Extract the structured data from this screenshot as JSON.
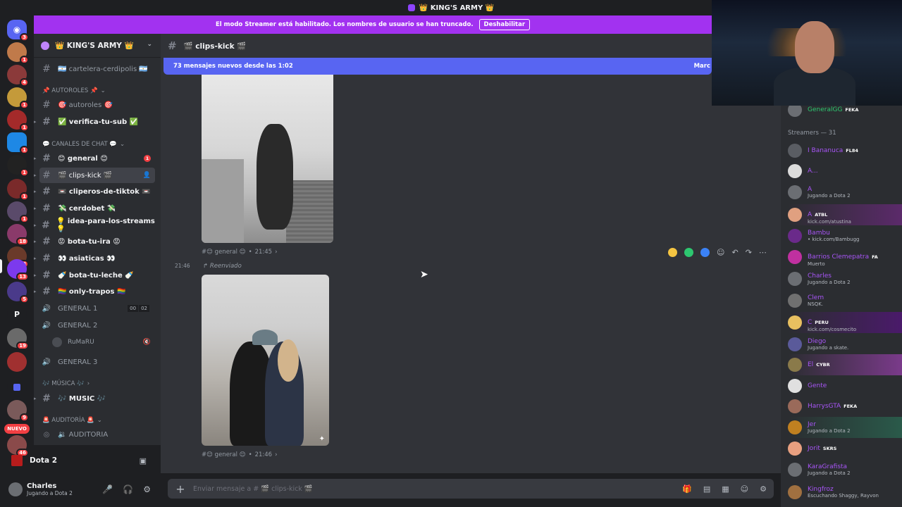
{
  "titlebar": {
    "title": "👑 KING'S ARMY 👑"
  },
  "streamer_banner": {
    "text": "El modo Streamer está habilitado. Los nombres de usuario se han truncado.",
    "button": "Deshabilitar"
  },
  "server": {
    "name": "👑 KING'S ARMY 👑"
  },
  "servers": {
    "badges": [
      "3",
      "1",
      "4",
      "1",
      "1",
      "1",
      "1",
      "1",
      "1",
      "18",
      "18",
      "13",
      "5",
      "19",
      "9",
      "46"
    ],
    "dm_letter": "P",
    "new_label": "NUEVO"
  },
  "channels": {
    "cartelera": "🇦🇷 cartelera-cerdipolis 🇦🇷",
    "cat_autoroles": "📌 AUTOROLES 📌",
    "autoroles": "🎯 autoroles 🎯",
    "verifica": "✅ verifica-tu-sub ✅",
    "cat_chat": "💬 CANALES DE CHAT 💬",
    "general": "😊 general 😊",
    "general_badge": "1",
    "clips": "🎬 clips-kick 🎬",
    "cliperos": "📼 cliperos-de-tiktok 📼",
    "cerdobet": "💸 cerdobet 💸",
    "idea": "💡 idea-para-los-streams 💡",
    "bota_ira": "😡 bota-tu-ira 😡",
    "asiaticas": "👀 asiaticas 👀",
    "bota_leche": "🍼 bota-tu-leche 🍼",
    "only": "🏳️‍🌈 only-trapos 🏳️‍🌈",
    "voice1": "GENERAL 1",
    "voice1_count": [
      "00",
      "02"
    ],
    "voice2": "GENERAL 2",
    "voice_user": "RuMaRU",
    "voice3": "GENERAL 3",
    "cat_music": "🎶 MÚSICA 🎶",
    "music": "🎶 MUSIC 🎶",
    "cat_audit": "🚨 AUDITORÍA 🚨",
    "auditoria": "🔉 AUDITORIA"
  },
  "game_activity": {
    "name": "Dota 2"
  },
  "user": {
    "name": "Charles",
    "status": "Jugando a Dota 2"
  },
  "channel_header": {
    "name": "🎬 clips-kick 🎬"
  },
  "new_messages": {
    "text": "73 mensajes nuevos desde las 1:02",
    "mark": "Marc"
  },
  "messages": [
    {
      "channel": "#😊 general 😊",
      "time": "21:45"
    },
    {
      "side_time": "21:46",
      "forwarded": "↱ Reenviado",
      "channel": "#😊 general 😊",
      "time": "21:46"
    }
  ],
  "input": {
    "placeholder": "Enviar mensaje a # 🎬 clips-kick 🎬"
  },
  "members": [
    {
      "name": "GeneralGG",
      "tag": "FEKA",
      "sub": "",
      "color": "#2dc770"
    },
    {
      "header": "Streamers — 31"
    },
    {
      "name": "I Bananuca",
      "tag": "FL84",
      "sub": ""
    },
    {
      "name": "A...",
      "tag": "",
      "sub": ""
    },
    {
      "name": "A",
      "tag": "",
      "sub": "Jugando a Dota 2"
    },
    {
      "name": "A",
      "tag": "ATBL",
      "sub": "kick.com/atustina"
    },
    {
      "name": "Bambu",
      "tag": "",
      "sub": "• kick.com/Bambugg"
    },
    {
      "name": "Barrios Clemepatra",
      "tag": "FA",
      "sub": "Muerto"
    },
    {
      "name": "Charles",
      "tag": "",
      "sub": "Jugando a Dota 2"
    },
    {
      "name": "Clem",
      "tag": "",
      "sub": "NSQK."
    },
    {
      "name": "C",
      "tag": "PERU",
      "sub": "kick.com/cosmecito"
    },
    {
      "name": "Diego",
      "tag": "",
      "sub": "Jugando a skate."
    },
    {
      "name": "El",
      "tag": "CYBR",
      "sub": ""
    },
    {
      "name": "Gente",
      "tag": "",
      "sub": ""
    },
    {
      "name": "HarrysGTA",
      "tag": "FEKA",
      "sub": ""
    },
    {
      "name": "Jer",
      "tag": "",
      "sub": "Jugando a Dota 2"
    },
    {
      "name": "Jorit",
      "tag": "SKRS",
      "sub": ""
    },
    {
      "name": "KaraGrafista",
      "tag": "",
      "sub": "Jugando a Dota 2"
    },
    {
      "name": "Kingfroz",
      "tag": "",
      "sub": "Escuchando Shaggy, Rayvon"
    }
  ]
}
